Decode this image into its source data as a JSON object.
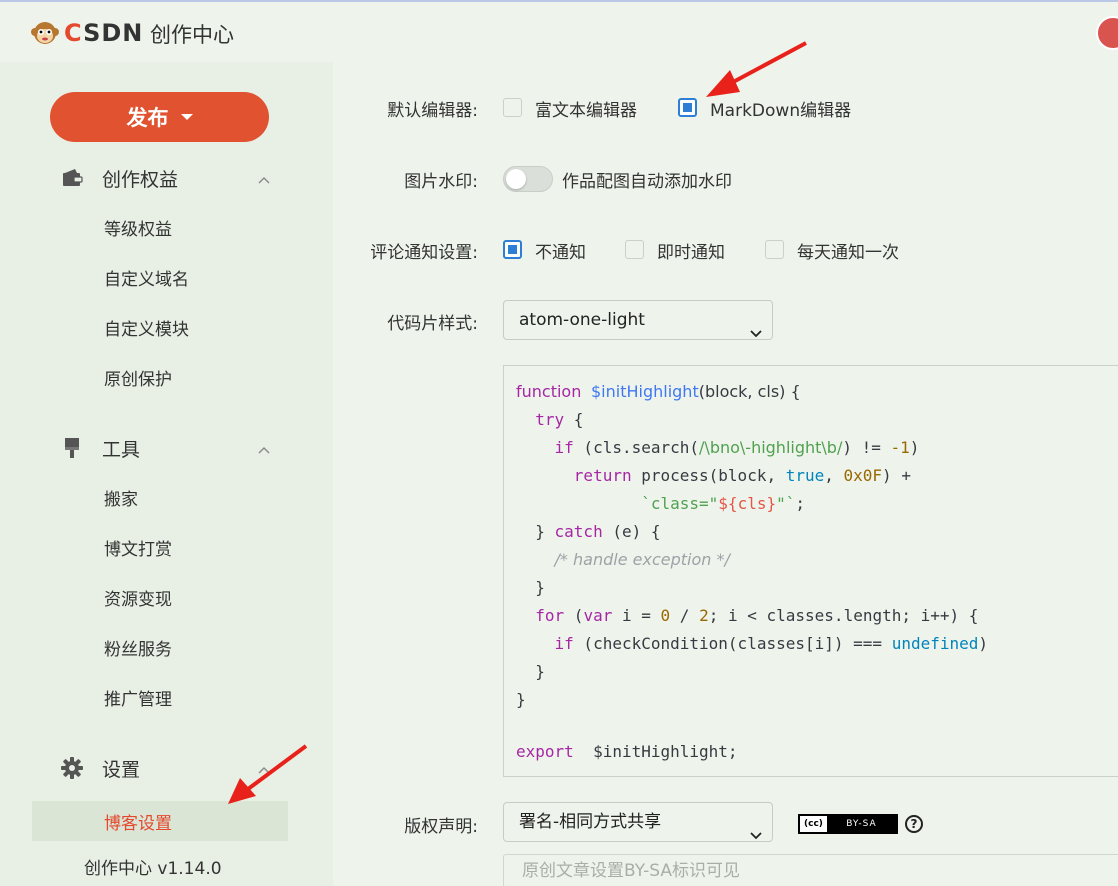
{
  "header": {
    "logo_text_c": "C",
    "logo_text_rest": "SDN",
    "title": "创作中心"
  },
  "sidebar": {
    "publish_label": "发布",
    "groups": [
      {
        "title": "创作权益",
        "items": [
          "等级权益",
          "自定义域名",
          "自定义模块",
          "原创保护"
        ]
      },
      {
        "title": "工具",
        "items": [
          "搬家",
          "博文打赏",
          "资源变现",
          "粉丝服务",
          "推广管理"
        ]
      },
      {
        "title": "设置",
        "items": [
          "博客设置"
        ]
      }
    ],
    "version": "创作中心 v1.14.0"
  },
  "settings": {
    "editor": {
      "label": "默认编辑器:",
      "options": [
        "富文本编辑器",
        "MarkDown编辑器"
      ],
      "selected": "MarkDown编辑器"
    },
    "watermark": {
      "label": "图片水印:",
      "text": "作品配图自动添加水印",
      "on": false
    },
    "comment": {
      "label": "评论通知设置:",
      "options": [
        "不通知",
        "即时通知",
        "每天通知一次"
      ],
      "selected": "不通知"
    },
    "code_style": {
      "label": "代码片样式:",
      "value": "atom-one-light"
    },
    "copyright": {
      "label": "版权声明:",
      "value": "署名-相同方式共享",
      "badge_left": "(cc)",
      "badge_right": "BY-SA",
      "hint": "原创文章设置BY-SA标识可见"
    }
  },
  "colors": {
    "accent": "#e05230",
    "checkbox": "#2d7fd6",
    "active_item": "#e4492d"
  }
}
